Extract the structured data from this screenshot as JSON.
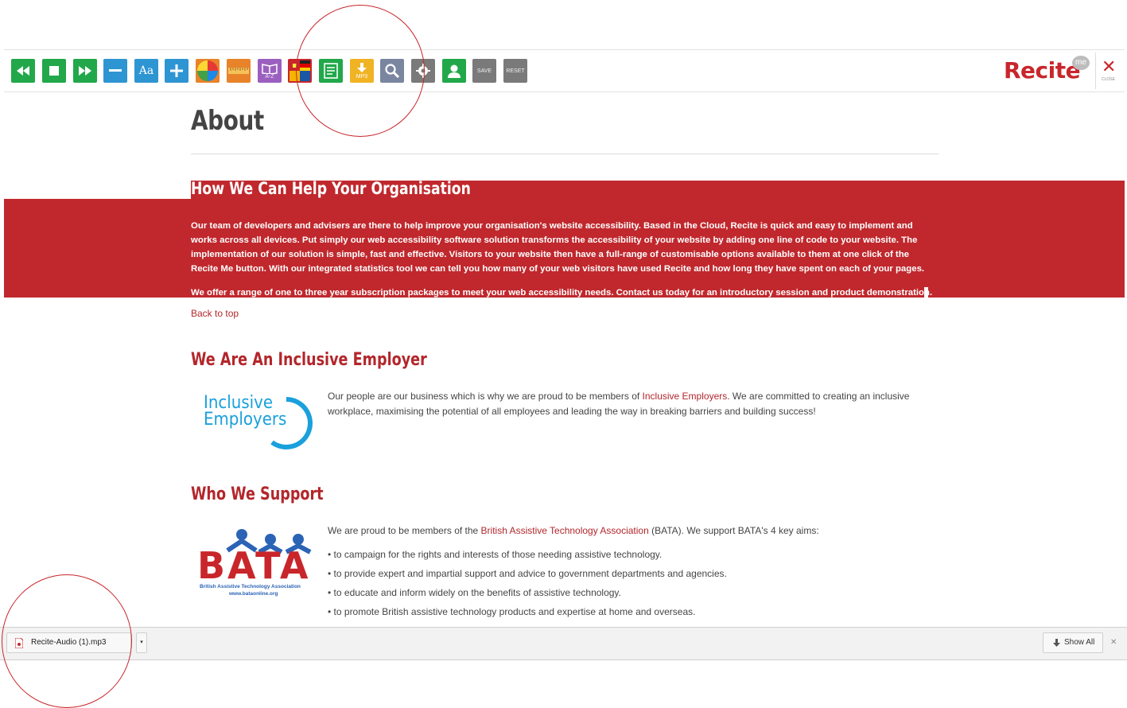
{
  "toolbar": {
    "buttons": [
      {
        "name": "rewind",
        "color": "#22a84a",
        "icon": "rewind-icon"
      },
      {
        "name": "stop",
        "color": "#22a84a",
        "icon": "stop-icon"
      },
      {
        "name": "forward",
        "color": "#22a84a",
        "icon": "fast-forward-icon"
      },
      {
        "name": "decrease-text",
        "color": "#2e95d3",
        "icon": "minus-icon"
      },
      {
        "name": "font",
        "color": "#2e95d3",
        "icon": "font-icon",
        "label": "Aa"
      },
      {
        "name": "increase-text",
        "color": "#2e95d3",
        "icon": "plus-icon"
      },
      {
        "name": "color-wheel",
        "color": "#e8832a",
        "icon": "color-wheel-icon"
      },
      {
        "name": "ruler",
        "color": "#e8832a",
        "icon": "ruler-icon"
      },
      {
        "name": "dictionary",
        "color": "#9b5fc0",
        "icon": "dictionary-icon",
        "label": "A-Z"
      },
      {
        "name": "translate",
        "color": "#c8262b",
        "icon": "flags-icon"
      },
      {
        "name": "text-mode",
        "color": "#22a84a",
        "icon": "text-mode-icon"
      },
      {
        "name": "download-mp3",
        "color": "#f0b323",
        "icon": "download-icon",
        "label": "MP3"
      },
      {
        "name": "search",
        "color": "#7a86a0",
        "icon": "search-icon"
      },
      {
        "name": "settings",
        "color": "#7a7a7a",
        "icon": "gear-icon"
      },
      {
        "name": "user",
        "color": "#22a84a",
        "icon": "user-icon"
      },
      {
        "name": "save",
        "color": "#7a7a7a",
        "label": "SAVE"
      },
      {
        "name": "reset",
        "color": "#7a7a7a",
        "label": "RESET"
      }
    ],
    "brand": "Recite",
    "brand_badge": "me",
    "close_label": "CLOSE",
    "close_glyph": "✕"
  },
  "page": {
    "title": "About",
    "section1": {
      "heading": "How We Can Help Your Organisation",
      "para1": "Our team of developers and advisers are there to help improve your organisation's website accessibility. Based in the Cloud, Recite is quick and easy to implement and works across all devices. Put simply our web accessibility software solution transforms the accessibility of your website by adding one line of code to your website. The implementation of our solution is simple, fast and effective. Visitors to your website then have a full-range of customisable options available to them at one click of the Recite Me button. With our integrated statistics tool we can tell you how many of your web visitors have used Recite and how long they have spent on each of your pages.",
      "para2": "We offer a range of one to three year subscription packages to meet your web accessibility needs. Contact us today for an introductory session and product demonstration.",
      "band_color": "#c0282d"
    },
    "back_to_top": "Back to top",
    "section2": {
      "heading": "We Are An Inclusive Employer",
      "logo_line1": "Inclusive",
      "logo_line2": "Employers",
      "text_before": "Our people are our business which is why we are proud to be members of ",
      "link": "Inclusive Employers",
      "text_after": ". We are committed to creating an inclusive workplace, maximising the potential of all employees and leading the way in breaking barriers and building success!"
    },
    "section3": {
      "heading": "Who We Support",
      "logo_text": "BATA",
      "logo_sub": "British Assistive Technology Association",
      "logo_url": "www.bataonline.org",
      "text_before": "We are proud to be members of the ",
      "link": "British Assistive Technology Association",
      "text_after": " (BATA). We support BATA's 4 key aims:",
      "bullets": [
        "to campaign for the rights and interests of those needing assistive technology.",
        "to provide expert and impartial support and advice to government departments and agencies.",
        "to educate and inform widely on the benefits of assistive technology.",
        "to promote British assistive technology products and expertise at home and overseas."
      ]
    }
  },
  "downloads": {
    "file": "Recite-Audio (1).mp3",
    "show_all": "Show All",
    "close_glyph": "✕"
  },
  "colors": {
    "accent": "#c8262b",
    "link": "#b3262b"
  }
}
